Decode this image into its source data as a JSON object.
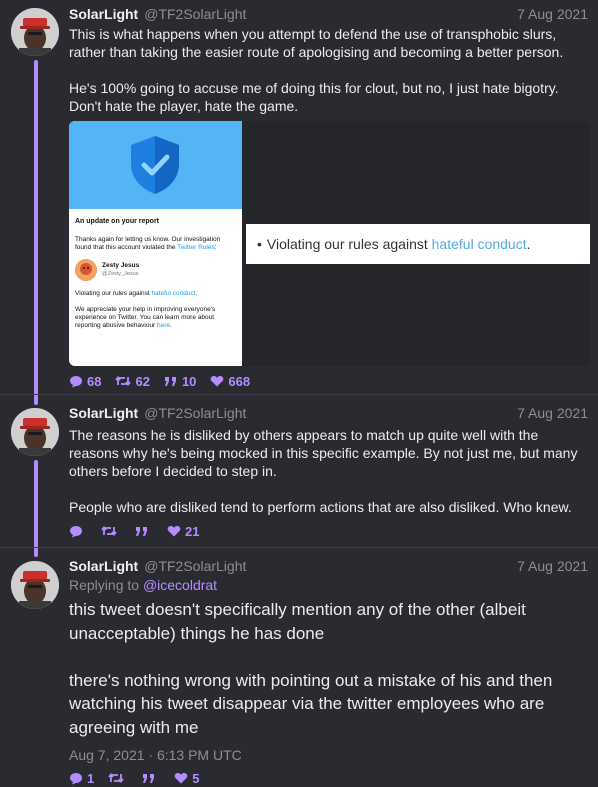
{
  "tweets": [
    {
      "name": "SolarLight",
      "handle": "@TF2SolarLight",
      "date": "7 Aug 2021",
      "paragraphs": [
        "This is what happens when you attempt to defend the use of transphobic slurs, rather than taking the easier route of apologising and becoming a better person.",
        "He's 100% going to accuse me of doing this for clout, but no, I just hate bigotry. Don't hate the player, hate the game."
      ],
      "media": {
        "card": {
          "title": "An update on your report",
          "text_before_link": "Thanks again for letting us know. Our investigation found that this account violated the ",
          "rules_link": "Twitter Rules",
          "text_after_link": ":",
          "user_name": "Zesty Jesus",
          "user_handle": "@Zesty_Jesus",
          "violation_prefix": "Violating our rules against ",
          "violation_link": "hateful conduct",
          "violation_suffix": ".",
          "closing_before_link": "We appreciate your help in improving everyone's experience on Twitter. You can learn more about reporting abusive behaviour ",
          "closing_link": "here",
          "closing_after_link": "."
        },
        "zoom": {
          "bullet": "•",
          "prefix": "Violating our rules against ",
          "link": "hateful conduct",
          "suffix": "."
        }
      },
      "stats": {
        "replies": "68",
        "retweets": "62",
        "quotes": "10",
        "likes": "668"
      }
    },
    {
      "name": "SolarLight",
      "handle": "@TF2SolarLight",
      "date": "7 Aug 2021",
      "paragraphs": [
        "The reasons he is disliked by others appears to match up quite well with the reasons why he's being mocked in this specific example. By not just me, but many others before I decided to step in.",
        "People who are disliked tend to perform actions that are also disliked. Who knew."
      ],
      "stats": {
        "replies": "",
        "retweets": "",
        "quotes": "",
        "likes": "21"
      }
    },
    {
      "name": "SolarLight",
      "handle": "@TF2SolarLight",
      "date": "7 Aug 2021",
      "replying_label": "Replying to ",
      "replying_to": "@icecoldrat",
      "paragraphs": [
        "this tweet doesn't specifically mention any of the other (albeit unacceptable) things he has done",
        "there's nothing wrong with pointing out a mistake of his and then watching his tweet disappear via the twitter employees who are agreeing with me"
      ],
      "timestamp": "Aug 7, 2021 · 6:13 PM UTC",
      "stats": {
        "replies": "1",
        "retweets": "",
        "quotes": "",
        "likes": "5"
      }
    }
  ],
  "colors": {
    "background": "#2a2b30",
    "accent": "#b58cff",
    "muted": "#8e8e8e",
    "link": "#58a9e0"
  }
}
